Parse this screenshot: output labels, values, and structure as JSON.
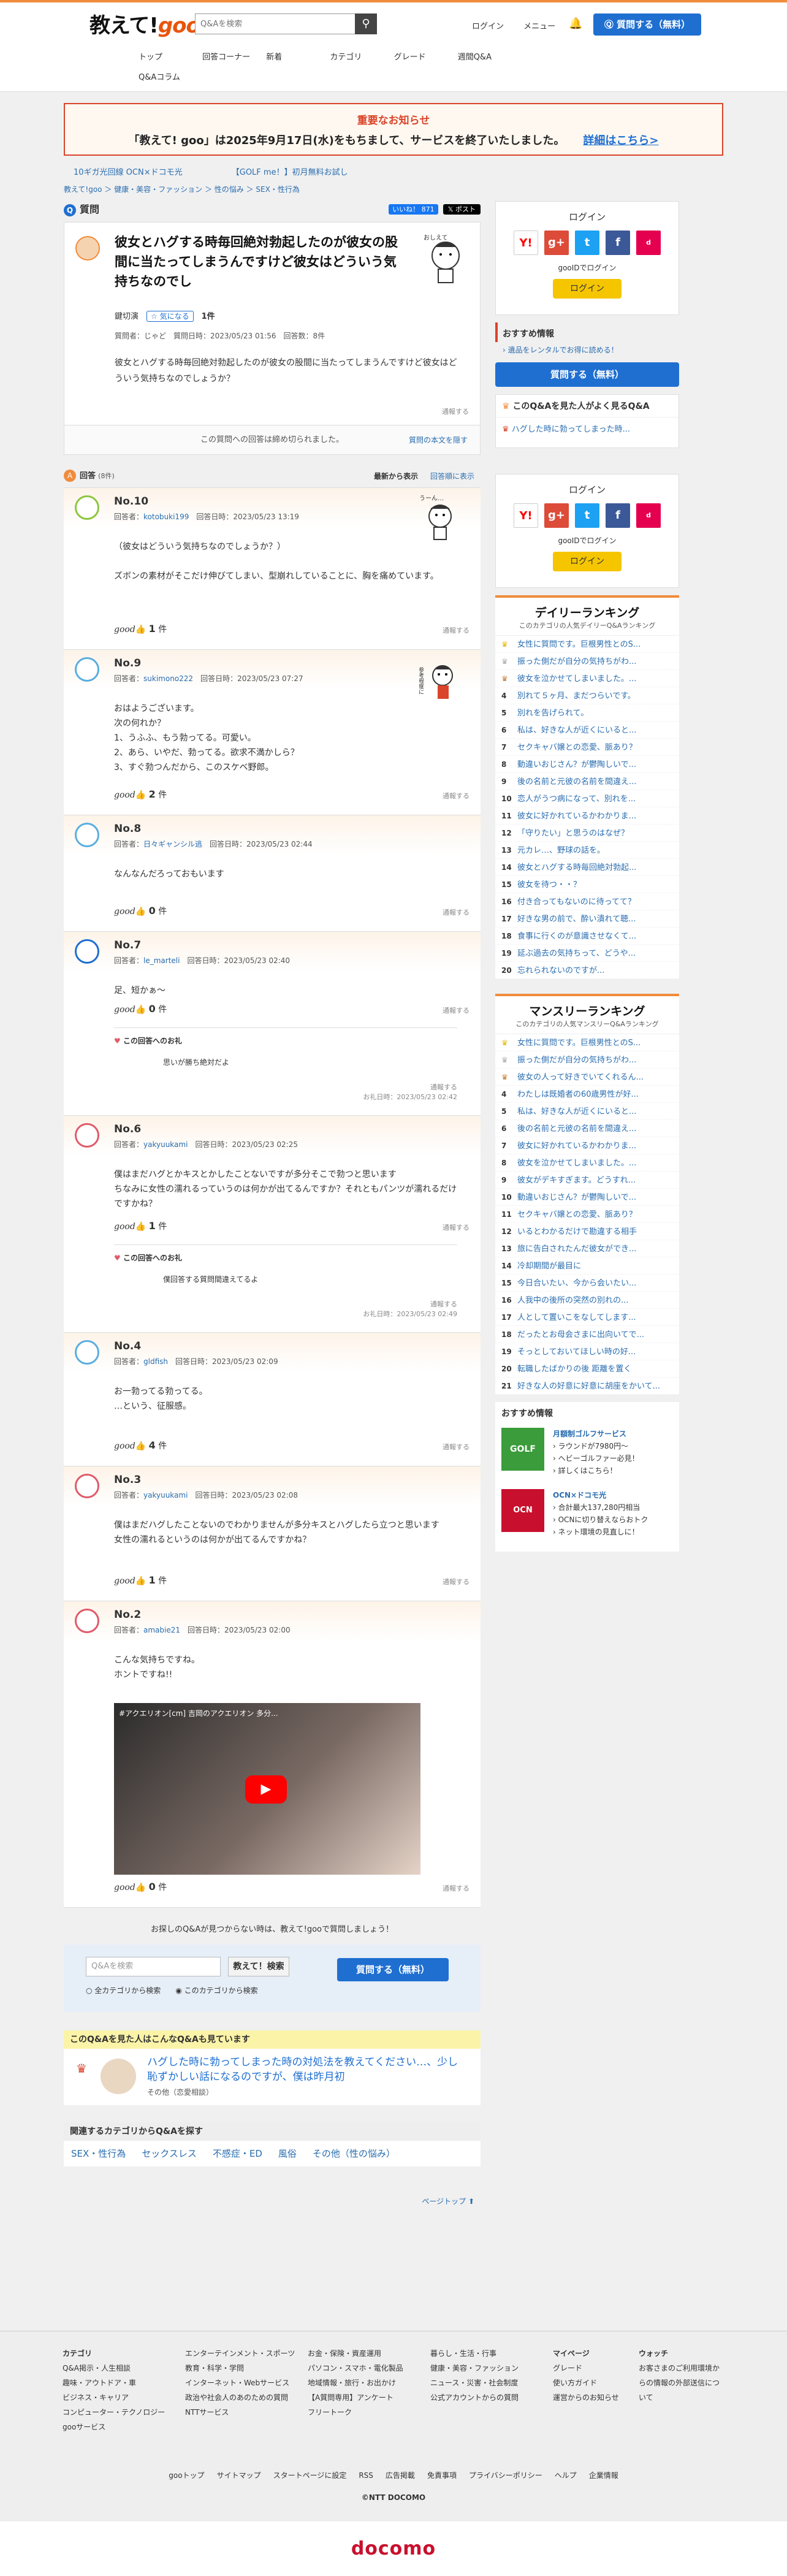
{
  "header": {
    "logo": "教えて!goo",
    "search_placeholder": "Q&Aを検索",
    "login": "ログイン",
    "menu": "メニュー",
    "ask": "質問する（無料）",
    "nav": [
      "トップ",
      "回答コーナー",
      "新着",
      "カテゴリ",
      "グレード",
      "週間Q&A",
      "Q&Aコラム"
    ]
  },
  "notice": {
    "title": "重要なお知らせ",
    "text": "「教えて! goo」は2025年9月17日(水)をもちまして、サービスを終了いたしました。",
    "link": "詳細はこちら>"
  },
  "adbar": [
    "10ギガ光回線 OCN×ドコモ光",
    "【GOLF me！】初月無料お試し"
  ],
  "breadcrumb": "教えて!goo ＞ 健康・美容・ファッション ＞ 性の悩み ＞ SEX・性行為",
  "question": {
    "section": "質問",
    "share": "いいね！ 871",
    "post": "ポスト",
    "title": "彼女とハグする時毎回絶対勃起したのが彼女の股間に当たってしまうんですけど彼女はどういう気持ちなのでし",
    "nickname": "鍵切演",
    "fav": "気になる",
    "fav_count": "1件",
    "meta": "質問者：じゃど　質問日時：2023/05/23 01:56　回答数：8件",
    "body": "彼女とハグする時毎回絶対勃起したのが彼女の股間に当たってしまうんですけど彼女はどういう気持ちなのでしょうか？",
    "report": "通報する",
    "closed": "この質問への回答は締め切られました。",
    "show_body": "質問の本文を隠す"
  },
  "answers_bar": {
    "title": "回答",
    "count": "(8件)",
    "sort_new": "最新から表示",
    "sort_old": "回答順に表示"
  },
  "answers": [
    {
      "no": "No.10",
      "user": "kotobuki199",
      "date": "回答日時：2023/05/23 13:19",
      "body": "（彼女はどういう気持ちなのでしょうか？）\n\nズボンの素材がそこだけ伸びてしまい、型崩れしていることに、胸を痛めています。",
      "good": "1",
      "unit": "件"
    },
    {
      "no": "No.9",
      "user": "sukimono222",
      "date": "回答日時：2023/05/23 07:27",
      "body": "おはようございます。\n次の何れか？\n1、うふふ、もう勃ってる。可愛い。\n2、あら、いやだ、勃ってる。欲求不満かしら？\n3、すぐ勃つんだから、このスケベ野郎。",
      "good": "2",
      "unit": "件"
    },
    {
      "no": "No.8",
      "user": "日々ギャンシル逃",
      "date": "回答日時：2023/05/23 02:44",
      "body": "なんなんだろっておもいます",
      "good": "0",
      "unit": "件"
    },
    {
      "no": "No.7",
      "user": "le_marteli",
      "date": "回答日時：2023/05/23 02:40",
      "body": "足、短かぁ〜",
      "good": "0",
      "unit": "件",
      "reply": {
        "title": "この回答へのお礼",
        "body": "思いが勝ち絶対だよ",
        "date": "お礼日時：2023/05/23 02:42"
      }
    },
    {
      "no": "No.6",
      "user": "yakyuukami",
      "date": "回答日時：2023/05/23 02:25",
      "body": "僕はまだハグとかキスとかしたことないですが多分そこで勃つと思います\nちなみに女性の濡れるっていうのは何かが出てるんですか？それともパンツが濡れるだけですかね？",
      "good": "1",
      "unit": "件",
      "reply": {
        "title": "この回答へのお礼",
        "body": "僕回答する質問間違えてるよ",
        "date": "お礼日時：2023/05/23 02:49"
      }
    },
    {
      "no": "No.4",
      "user": "gldfish",
      "date": "回答日時：2023/05/23 02:09",
      "body": "お一勃ってる勃ってる。\n…という、征服感。",
      "good": "4",
      "unit": "件"
    },
    {
      "no": "No.3",
      "user": "yakyuukami",
      "date": "回答日時：2023/05/23 02:08",
      "body": "僕はまだハグしたことないのでわかりませんが多分キスとハグしたら立つと思います\n女性の濡れるというのは何かが出てるんですかね？",
      "good": "1",
      "unit": "件"
    },
    {
      "no": "No.2",
      "user": "amabie21",
      "date": "回答日時：2023/05/23 02:00",
      "body": "こんな気持ちですね。\nホントですね!!",
      "good": "0",
      "unit": "件",
      "video": "#アクエリオン[cm] 吉岡のアクエリオン 多分..."
    }
  ],
  "report": "通報する",
  "illus": {
    "a10": "うーん…",
    "a9": "参考程度に"
  },
  "bottom": {
    "prompt": "お探しのQ&Aが見つからない時は、教えて!gooで質問しましょう！",
    "placeholder": "Q&Aを検索",
    "button": "教えて！検索",
    "radio1": "全カテゴリから検索",
    "radio2": "このカテゴリから検索",
    "ask": "質問する（無料）"
  },
  "related": {
    "header": "このQ&Aを見た人はこんなQ&Aも見ています",
    "title": "ハグした時に勃ってしまった時の対処法を教えてください…、少し恥ずかしい話になるのですが、僕は昨月初",
    "cat": "その他（恋愛相談）"
  },
  "cats": {
    "header": "関連するカテゴリからQ&Aを探す",
    "items": [
      "SEX・性行為",
      "セックスレス",
      "不感症・ED",
      "風俗",
      "その他（性の悩み）"
    ]
  },
  "pagetop": "ページトップ",
  "side": {
    "login_title": "ログイン",
    "goo_login": "gooIDでログイン",
    "login_btn": "ログイン",
    "osusume": "おすすめ情報",
    "osusume_link": "› 遺品をレンタルでお得に読める！",
    "ask": "質問する（無料）",
    "also_seen": "このQ&Aを見た人がよく見るQ&A",
    "also_link": "ハグした時に勃ってしまった時...",
    "daily": {
      "title": "デイリーランキング",
      "sub": "このカテゴリの人気デイリーQ&Aランキング",
      "items": [
        "女性に質問です。巨根男性とのS...",
        "振った側だが自分の気持ちがわ...",
        "彼女を泣かせてしまいました。...",
        "別れて５ヶ月、まだつらいです。",
        "別れを告げられて。",
        "私は、好きな人が近くにいると...",
        "セクキャバ嬢との恋愛、脈あり？",
        "動違いおじさん？が鬱陶しいで...",
        "後の名前と元彼の名前を間違え...",
        "恋人がうつ病になって、別れを...",
        "彼女に好かれているかわかりま...",
        "「守りたい」と思うのはなぜ？",
        "元カレ…、野球の話を。",
        "彼女とハグする時毎回絶対勃起...",
        "彼女を待つ・・？",
        "付き合ってもないのに待ってて？",
        "好きな男の前で、酔い潰れて聴...",
        "食事に行くのが意識させなくて...",
        "延ぶ過去の気持ちって、どうや...",
        "忘れられないのですが..."
      ]
    },
    "monthly": {
      "title": "マンスリーランキング",
      "sub": "このカテゴリの人気マンスリーQ&Aランキング",
      "items": [
        "女性に質問です。巨根男性とのS...",
        "振った側だが自分の気持ちがわ...",
        "彼女の人って好きでいてくれるん...",
        "わたしは既婚者の60歳男性が好...",
        "私は、好きな人が近くにいると...",
        "後の名前と元彼の名前を間違え...",
        "彼女に好かれているかわかりま...",
        "彼女を泣かせてしまいました。...",
        "彼女がデキすぎます。どうすれ...",
        "動違いおじさん？が鬱陶しいで...",
        "セクキャバ嬢との恋愛、脈あり？",
        "いるとわかるだけで勘違する相手",
        "旅に告白されたんだ彼女ができ...",
        "冷却期間が最目に",
        "今日合いたい、今から会いたい...",
        "人我中の後所の突然の別れの...",
        "人として置いこをなしてします...",
        "だったとお母会さまに出向いてで...",
        "そっとしておいてほしい時の好...",
        "転職したばかりの後 距離を置く",
        "好きな人の好意に好意に胡座をかいて..."
      ]
    },
    "rec_title": "おすすめ情報",
    "rec1": {
      "title": "月額制ゴルフサービス",
      "l1": "› ラウンドが7980円〜",
      "l2": "› ヘビーゴルファー必見！",
      "l3": "› 詳しくはこちら！"
    },
    "rec2": {
      "title": "OCN×ドコモ光",
      "l1": "› 合計最大137,280円相当",
      "l2": "› OCNに切り替えならおトク",
      "l3": "› ネット環境の見直しに！"
    }
  },
  "footer": {
    "cols": [
      {
        "h": "カテゴリ",
        "items": [
          "Q&A掲示・人生相談",
          "趣味・アウトドア・車",
          "ビジネス・キャリア",
          "コンピューター・テクノロジー",
          "gooサービス"
        ]
      },
      {
        "h": "",
        "items": [
          "エンターテインメント・スポーツ",
          "教育・科学・学問",
          "インターネット・Webサービス",
          "政治や社会人のあのための質問",
          "NTTサービス"
        ]
      },
      {
        "h": "",
        "items": [
          "お金・保険・資産運用",
          "パソコン・スマホ・電化製品",
          "地域情報・旅行・お出かけ",
          "【A質問専用】アンケート",
          "フリートーク"
        ]
      },
      {
        "h": "",
        "items": [
          "暮らし・生活・行事",
          "健康・美容・ファッション",
          "ニュース・災害・社会制度",
          "公式アカウントからの質問"
        ]
      },
      {
        "h": "マイページ",
        "items": [
          "グレード",
          "使い方ガイド",
          "運営からのお知らせ"
        ]
      },
      {
        "h": "ウォッチ",
        "items": [
          "お客さまのご利用環境からの情報の外部送信について"
        ]
      }
    ],
    "links": [
      "gooトップ",
      "サイトマップ",
      "スタートページに設定",
      "RSS",
      "広告掲載",
      "免責事項",
      "プライバシーポリシー",
      "ヘルプ",
      "企業情報"
    ],
    "copy": "©NTT DOCOMO",
    "brand": "docomo"
  },
  "colors": {
    "accent": "#f08c3c",
    "primary": "#1f6fd1",
    "notice": "#d9442a"
  }
}
